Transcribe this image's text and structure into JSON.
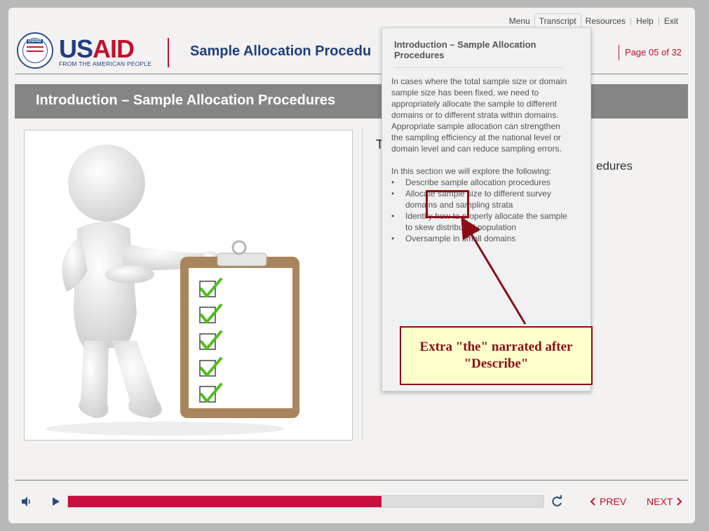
{
  "nav": {
    "items": [
      "Menu",
      "Transcript",
      "Resources",
      "Help",
      "Exit"
    ],
    "active": "Transcript"
  },
  "header": {
    "seal_text": "USAID",
    "brand_us": "US",
    "brand_aid": "AID",
    "brand_tagline": "FROM THE AMERICAN PEOPLE",
    "course_title": "Sample Allocation Procedu",
    "page_indicator": "Page 05 of  32"
  },
  "slide": {
    "title": "Introduction – Sample Allocation Procedures",
    "obscured_text_1": "T",
    "obscured_text_2": "edures",
    "image_icon": "figure-with-clipboard-checklist"
  },
  "transcript": {
    "title": "Introduction – Sample Allocation Procedures",
    "paragraph_1": "In cases where the total sample size or domain sample size has been fixed, we need to appropriately allocate the sample to different domains or to different strata within domains. Appropriate sample allocation can strengthen the sampling efficiency at the national level or domain level and can reduce sampling errors.",
    "paragraph_2": "In this section we will explore the following:",
    "bullets": [
      "Describe sample allocation procedures",
      "Allocate sample size to different survey domains and sampling strata",
      "Identify how to properly allocate the sample to skew distributed population",
      "Oversample in small domains"
    ],
    "bullet_char": "•"
  },
  "annotation": {
    "callout_text": "Extra \"the\" narrated after \"Describe\"",
    "color": "#8b0e17",
    "fill": "#ffffcc"
  },
  "player": {
    "progress": 0.66,
    "prev_label": "PREV",
    "next_label": "NEXT",
    "accent": "#c8103e",
    "icons": [
      "volume-icon",
      "play-icon",
      "replay-icon",
      "chevron-left-icon",
      "chevron-right-icon"
    ]
  }
}
